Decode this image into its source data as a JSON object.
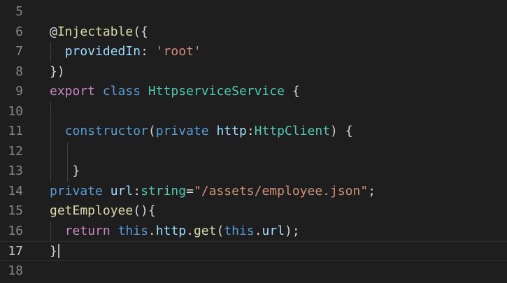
{
  "editor": {
    "lines": [
      {
        "num": "5",
        "tokens": []
      },
      {
        "num": "6",
        "tokens": [
          {
            "t": "@",
            "c": "t-punct"
          },
          {
            "t": "Injectable",
            "c": "t-fn"
          },
          {
            "t": "({",
            "c": "t-punct"
          }
        ]
      },
      {
        "num": "7",
        "tokens": [
          {
            "t": "  ",
            "c": "t-punct"
          },
          {
            "t": "providedIn",
            "c": "t-prop"
          },
          {
            "t": ": ",
            "c": "t-punct"
          },
          {
            "t": "'root'",
            "c": "t-str"
          }
        ]
      },
      {
        "num": "8",
        "tokens": [
          {
            "t": "})",
            "c": "t-punct"
          }
        ]
      },
      {
        "num": "9",
        "tokens": [
          {
            "t": "export",
            "c": "t-ctl"
          },
          {
            "t": " ",
            "c": "t-punct"
          },
          {
            "t": "class",
            "c": "t-kw"
          },
          {
            "t": " ",
            "c": "t-punct"
          },
          {
            "t": "HttpserviceService",
            "c": "t-type"
          },
          {
            "t": " {",
            "c": "t-punct"
          }
        ]
      },
      {
        "num": "10",
        "tokens": []
      },
      {
        "num": "11",
        "tokens": [
          {
            "t": "  ",
            "c": "t-punct"
          },
          {
            "t": "constructor",
            "c": "t-kw"
          },
          {
            "t": "(",
            "c": "t-punct"
          },
          {
            "t": "private",
            "c": "t-kw"
          },
          {
            "t": " ",
            "c": "t-punct"
          },
          {
            "t": "http",
            "c": "t-prop"
          },
          {
            "t": ":",
            "c": "t-punct"
          },
          {
            "t": "HttpClient",
            "c": "t-type"
          },
          {
            "t": ") {",
            "c": "t-punct"
          }
        ]
      },
      {
        "num": "12",
        "tokens": []
      },
      {
        "num": "13",
        "tokens": [
          {
            "t": "   }",
            "c": "t-punct"
          }
        ]
      },
      {
        "num": "14",
        "tokens": [
          {
            "t": "private",
            "c": "t-kw"
          },
          {
            "t": " ",
            "c": "t-punct"
          },
          {
            "t": "url",
            "c": "t-prop"
          },
          {
            "t": ":",
            "c": "t-punct"
          },
          {
            "t": "string",
            "c": "t-type"
          },
          {
            "t": "=",
            "c": "t-punct"
          },
          {
            "t": "\"/assets/employee.json\"",
            "c": "t-str"
          },
          {
            "t": ";",
            "c": "t-punct"
          }
        ]
      },
      {
        "num": "15",
        "tokens": [
          {
            "t": "getEmployee",
            "c": "t-fn"
          },
          {
            "t": "(){",
            "c": "t-punct"
          }
        ]
      },
      {
        "num": "16",
        "tokens": [
          {
            "t": "  ",
            "c": "t-punct"
          },
          {
            "t": "return",
            "c": "t-ctl"
          },
          {
            "t": " ",
            "c": "t-punct"
          },
          {
            "t": "this",
            "c": "t-kw"
          },
          {
            "t": ".",
            "c": "t-punct"
          },
          {
            "t": "http",
            "c": "t-prop"
          },
          {
            "t": ".",
            "c": "t-punct"
          },
          {
            "t": "get",
            "c": "t-fn"
          },
          {
            "t": "(",
            "c": "t-punct"
          },
          {
            "t": "this",
            "c": "t-kw"
          },
          {
            "t": ".",
            "c": "t-punct"
          },
          {
            "t": "url",
            "c": "t-prop"
          },
          {
            "t": ");",
            "c": "t-punct"
          }
        ]
      },
      {
        "num": "17",
        "tokens": [
          {
            "t": "}",
            "c": "t-punct"
          }
        ],
        "current": true
      },
      {
        "num": "18",
        "tokens": []
      }
    ]
  },
  "colors": {
    "background": "#1e1e1e",
    "line_number": "#858585",
    "line_number_active": "#c6c6c6",
    "keyword": "#569cd6",
    "control": "#c586c0",
    "function": "#dcdcaa",
    "type": "#4ec9b0",
    "property": "#9cdcfe",
    "string": "#ce9178"
  }
}
